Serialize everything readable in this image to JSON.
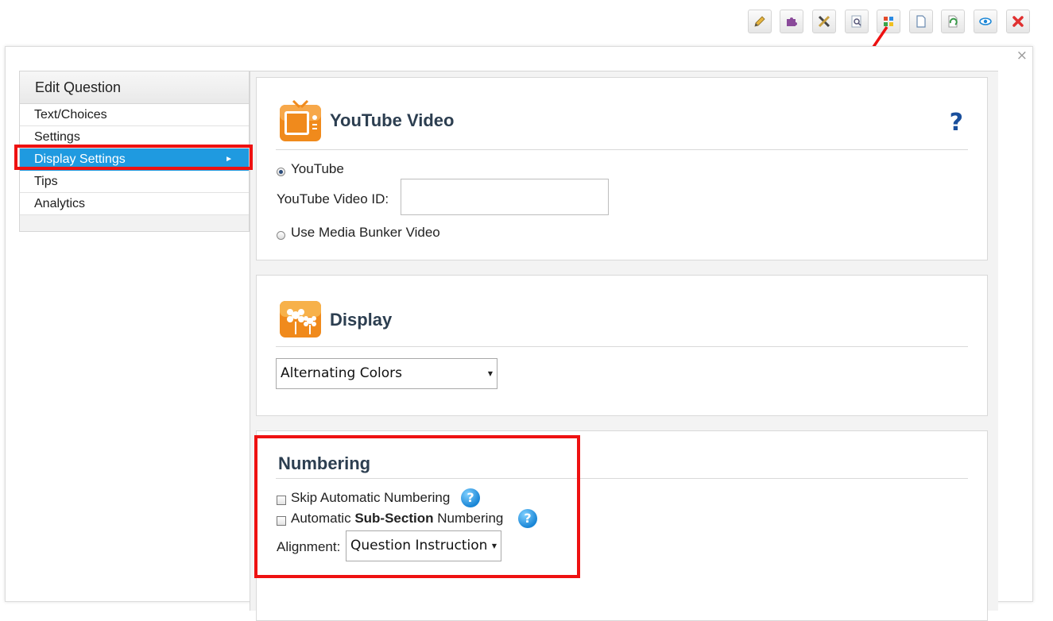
{
  "toolbar": {
    "buttons": [
      {
        "name": "edit-pencil-icon",
        "color": "#e0a030"
      },
      {
        "name": "puzzle-icon",
        "color": "#8a4a9a"
      },
      {
        "name": "tools-icon",
        "color": "#555555"
      },
      {
        "name": "preview-magnifier-icon",
        "color": "#6a8ab0"
      },
      {
        "name": "layout-grid-icon",
        "color": "#e34a2a"
      },
      {
        "name": "copy-page-icon",
        "color": "#6a8ab0"
      },
      {
        "name": "refresh-page-icon",
        "color": "#3a9a4a"
      },
      {
        "name": "eye-icon",
        "color": "#1a86d6"
      },
      {
        "name": "delete-x-icon",
        "color": "#e03030"
      }
    ]
  },
  "dialog": {
    "close_glyph": "×"
  },
  "sidebar": {
    "title": "Edit Question",
    "items": [
      {
        "label": "Text/Choices"
      },
      {
        "label": "Settings"
      },
      {
        "label": "Display Settings",
        "active": true,
        "caret": "►"
      },
      {
        "label": "Tips"
      },
      {
        "label": "Analytics"
      }
    ]
  },
  "youtube_section": {
    "title": "YouTube Video",
    "help_glyph": "?",
    "option_youtube": "YouTube",
    "video_id_label": "YouTube Video ID:",
    "video_id_value": "",
    "option_media_bunker": "Use Media Bunker Video"
  },
  "display_section": {
    "title": "Display",
    "style_select_value": "Alternating Colors",
    "arrow_glyph": "▼"
  },
  "numbering_section": {
    "title": "Numbering",
    "skip_label": "Skip Automatic Numbering",
    "subsection_prefix": "Automatic ",
    "subsection_bold": "Sub-Section",
    "subsection_suffix": " Numbering",
    "help_glyph": "?",
    "alignment_label": "Alignment:",
    "alignment_value": "Question Instruction",
    "arrow_glyph": "▼"
  },
  "colors": {
    "accent": "#1f9ae0",
    "highlight": "#ee1111",
    "title_text": "#2c3e50"
  }
}
